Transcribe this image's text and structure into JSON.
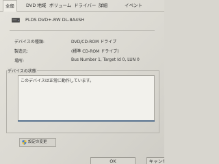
{
  "tabs": [
    {
      "label": "全般"
    },
    {
      "label": "DVD 地域"
    },
    {
      "label": "ボリューム"
    },
    {
      "label": "ドライバー"
    },
    {
      "label": "詳細"
    },
    {
      "label": "イベント"
    }
  ],
  "device": {
    "name": "PLDS DVD+-RW DL-8A4SH",
    "icon": "dvd-drive-icon"
  },
  "properties": [
    {
      "label": "デバイスの種類:",
      "value": "DVD/CD-ROM ドライブ"
    },
    {
      "label": "製造元:",
      "value": "(標準 CD-ROM ドライブ)"
    },
    {
      "label": "場所:",
      "value": "Bus Number 1, Target Id 0, LUN 0"
    }
  ],
  "status": {
    "title": "デバイスの状態",
    "text": "このデバイスは正常に動作しています。"
  },
  "buttons": {
    "change_settings": "設定の変更",
    "ok": "OK",
    "cancel": "キャンセル"
  },
  "colors": {
    "accent_line": "#55708d"
  }
}
